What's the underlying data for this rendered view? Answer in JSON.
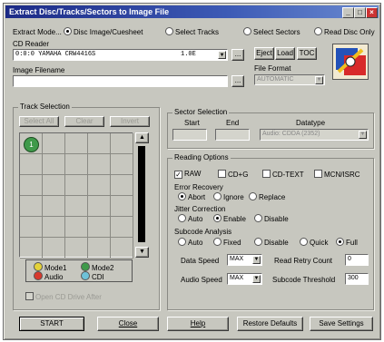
{
  "window": {
    "title": "Extract Disc/Tracks/Sectors to Image File",
    "min_btn": "_",
    "max_btn": "□",
    "close_btn": "×"
  },
  "extract_mode": {
    "label": "Extract Mode...",
    "options": [
      {
        "label": "Disc Image/Cuesheet",
        "selected": true
      },
      {
        "label": "Select Tracks",
        "selected": false
      },
      {
        "label": "Select Sectors",
        "selected": false
      },
      {
        "label": "Read Disc Only",
        "selected": false
      }
    ]
  },
  "cd_reader": {
    "label": "CD Reader",
    "value": "0:0:0 YAMAHA   CRW4416S",
    "version": "1.0E",
    "browse": "...",
    "eject": "Eject",
    "load": "Load",
    "toc": "TOC"
  },
  "image_file": {
    "label": "Image Filename",
    "value": "",
    "browse": "..."
  },
  "file_format": {
    "label": "File Format",
    "value": "AUTOMATIC"
  },
  "track_selection": {
    "title": "Track Selection",
    "buttons": [
      "Select All",
      "Clear",
      "Invert"
    ],
    "first_track": "1",
    "legend": [
      {
        "label": "Mode1",
        "color": "#e4d23a"
      },
      {
        "label": "Mode2",
        "color": "#3f9a4a"
      },
      {
        "label": "Audio",
        "color": "#d83a2e"
      },
      {
        "label": "CDI",
        "color": "#6fc2d8"
      }
    ],
    "open_drive": "Open CD Drive After"
  },
  "sector_selection": {
    "title": "Sector Selection",
    "start_label": "Start",
    "end_label": "End",
    "datatype_label": "Datatype",
    "datatype_value": "Audio: CDDA (2352)"
  },
  "reading_options": {
    "title": "Reading Options",
    "checks": [
      {
        "label": "RAW",
        "checked": true
      },
      {
        "label": "CD+G",
        "checked": false
      },
      {
        "label": "CD-TEXT",
        "checked": false
      },
      {
        "label": "MCN/ISRC",
        "checked": false
      }
    ],
    "error_recovery": {
      "label": "Error Recovery",
      "options": [
        {
          "label": "Abort",
          "selected": true
        },
        {
          "label": "Ignore",
          "selected": false
        },
        {
          "label": "Replace",
          "selected": false
        }
      ]
    },
    "jitter": {
      "label": "Jitter Correction",
      "options": [
        {
          "label": "Auto",
          "selected": false
        },
        {
          "label": "Enable",
          "selected": true
        },
        {
          "label": "Disable",
          "selected": false
        }
      ]
    },
    "subcode": {
      "label": "Subcode Analysis",
      "options": [
        {
          "label": "Auto",
          "selected": false
        },
        {
          "label": "Fixed",
          "selected": false
        },
        {
          "label": "Disable",
          "selected": false
        },
        {
          "label": "Quick",
          "selected": false
        },
        {
          "label": "Full",
          "selected": true
        }
      ]
    },
    "data_speed_label": "Data Speed",
    "data_speed": "MAX",
    "audio_speed_label": "Audio Speed",
    "audio_speed": "MAX",
    "read_retry_label": "Read Retry Count",
    "read_retry": "0",
    "subcode_threshold_label": "Subcode Threshold",
    "subcode_threshold": "300"
  },
  "footer": {
    "start": "START",
    "close": "Close",
    "help": "Help",
    "restore": "Restore Defaults",
    "save": "Save Settings"
  }
}
